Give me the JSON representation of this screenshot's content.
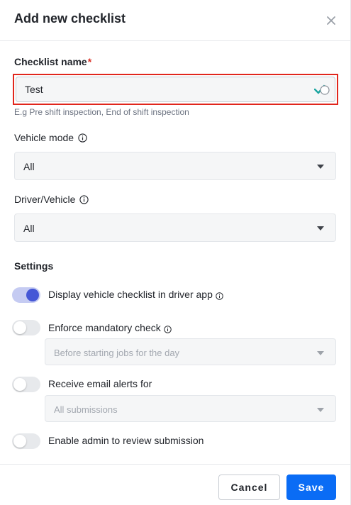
{
  "dialog": {
    "title": "Add new checklist",
    "close_icon": "close-icon"
  },
  "checklist_name": {
    "label": "Checklist name",
    "required_mark": "*",
    "value": "Test",
    "valid_icon": "check-icon",
    "hint": "E.g Pre shift inspection, End of shift inspection"
  },
  "vehicle_mode": {
    "label": "Vehicle mode",
    "info_icon": "info-icon",
    "selected": "All"
  },
  "driver_vehicle": {
    "label": "Driver/Vehicle",
    "info_icon": "info-icon",
    "selected": "All"
  },
  "settings": {
    "title": "Settings",
    "display_checklist": {
      "label": "Display vehicle checklist in driver app",
      "enabled": true
    },
    "enforce_mandatory": {
      "label": "Enforce mandatory check",
      "enabled": false,
      "select_value": "Before starting jobs for the day"
    },
    "email_alerts": {
      "label": "Receive email alerts for",
      "enabled": false,
      "select_value": "All submissions"
    },
    "admin_review": {
      "label": "Enable admin to review submission",
      "enabled": false
    }
  },
  "footer": {
    "cancel_label": "Cancel",
    "save_label": "Save"
  },
  "colors": {
    "primary": "#0a6cf5",
    "required": "#d93025",
    "toggle_on": "#4557d6",
    "highlight": "#e1261c",
    "valid_check": "#1aa5a0"
  }
}
